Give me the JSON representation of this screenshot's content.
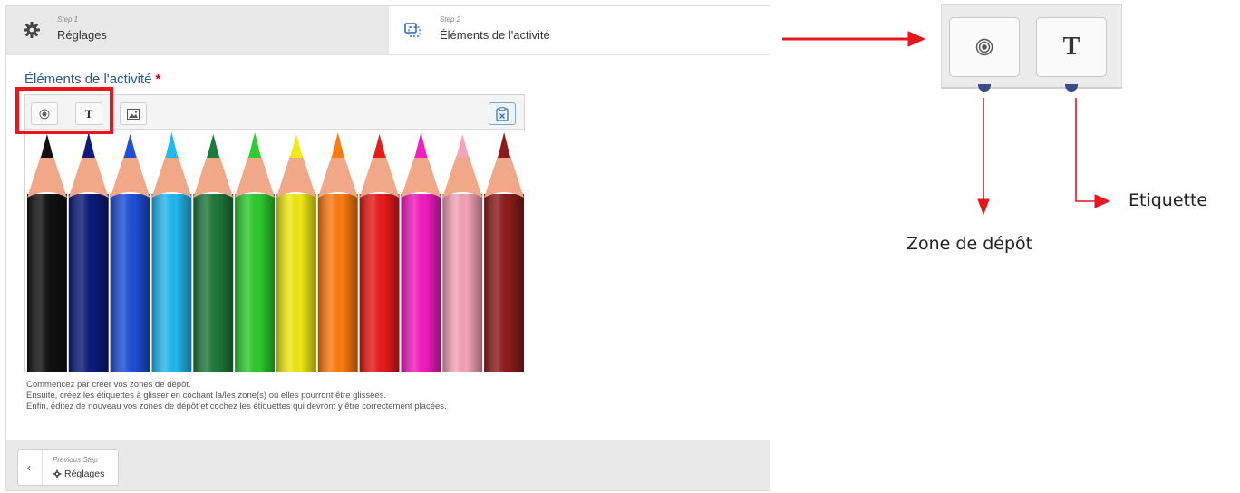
{
  "steps": [
    {
      "small": "Step 1",
      "name": "Réglages",
      "icon": "gear-icon"
    },
    {
      "small": "Step 2",
      "name": "Éléments de l'activité",
      "icon": "layers-icon"
    }
  ],
  "section": {
    "title": "Éléments de l'activité",
    "required_mark": "*"
  },
  "toolbar": {
    "dropzone_icon": "target-icon",
    "label_glyph": "T",
    "image_icon": "image-icon",
    "delete_icon": "delete-clipboard-icon"
  },
  "help": {
    "line1": "Commencez par créer vos zones de dépôt.",
    "line2": "Ensuite, créez les étiquettes à glisser en cochant la/les zone(s) où elles pourront être glissées.",
    "line3": "Enfin, éditez de nouveau vos zones de dépôt et cochez les étiquettes qui devront y être correctement placées."
  },
  "footer": {
    "prev_small": "Previous Step",
    "prev_name": "Réglages"
  },
  "annotation": {
    "zoom_label_glyph": "T",
    "zone_label": "Zone de dépôt",
    "etiquette_label": "Etiquette",
    "arrow_color": "#e8151c"
  },
  "pencil_colors": [
    "#111111",
    "#0c1a7a",
    "#1e4fd6",
    "#22b8f0",
    "#1d7a3a",
    "#2ecc2e",
    "#f1ea12",
    "#ff7a10",
    "#e81a1a",
    "#f41bc0",
    "#f5a3b8",
    "#8c1c1c"
  ]
}
